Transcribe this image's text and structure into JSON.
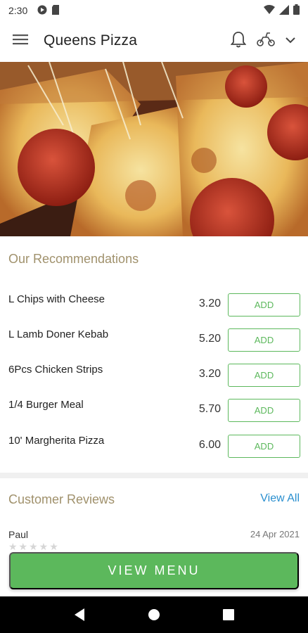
{
  "status_bar": {
    "time": "2:30",
    "icons": [
      "media-icon",
      "sd-card-icon",
      "wifi-icon",
      "signal-icon",
      "battery-icon"
    ]
  },
  "app_bar": {
    "title": "Queens Pizza",
    "icons": [
      "menu-icon",
      "bell-icon",
      "scooter-icon",
      "chevron-down-icon"
    ]
  },
  "hero": {
    "image": "pizza-photo"
  },
  "recommendations": {
    "title": "Our Recommendations",
    "add_label": "ADD",
    "items": [
      {
        "name": "L Chips with Cheese",
        "price": "3.20"
      },
      {
        "name": "L Lamb Doner Kebab",
        "price": "5.20"
      },
      {
        "name": "6Pcs Chicken Strips",
        "price": "3.20"
      },
      {
        "name": "1/4 Burger Meal",
        "price": "5.70"
      },
      {
        "name": "10' Margherita Pizza",
        "price": "6.00"
      }
    ]
  },
  "reviews": {
    "title": "Customer Reviews",
    "view_all": "View All",
    "items": [
      {
        "reviewer": "Paul",
        "date": "24 Apr 2021",
        "stars": "★★★★★"
      }
    ]
  },
  "cta": {
    "label": "VIEW MENU"
  },
  "colors": {
    "accent_green": "#5cb85c",
    "section_title": "#a0916c",
    "link_blue": "#2a8fcf"
  }
}
